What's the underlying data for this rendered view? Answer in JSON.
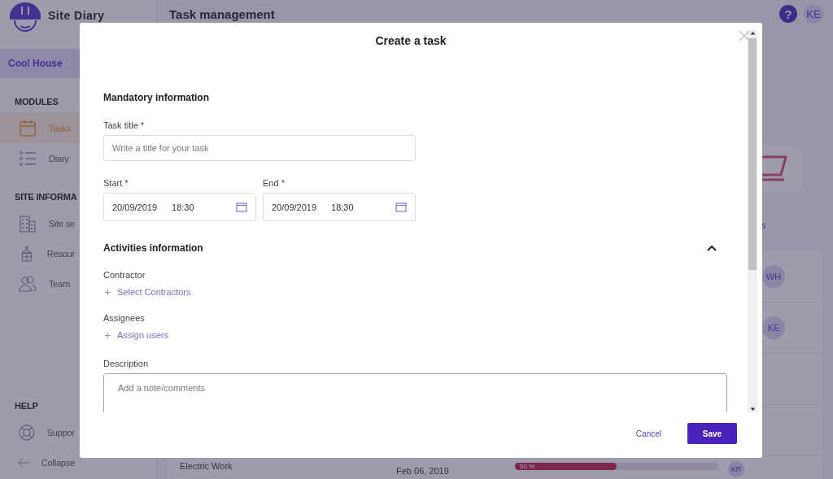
{
  "sidebar": {
    "app_name": "Site Diary",
    "project": "Cool House",
    "sections": [
      {
        "heading": "MODULES",
        "items": [
          {
            "label": "Tasks",
            "selected": true
          },
          {
            "label": "Diary",
            "selected": false
          }
        ]
      },
      {
        "heading": "SITE INFORMA",
        "items": [
          {
            "label": "Site se",
            "selected": false
          },
          {
            "label": "Resour",
            "selected": false
          },
          {
            "label": "Team",
            "selected": false
          }
        ]
      }
    ],
    "help": {
      "heading": "HELP",
      "items": [
        {
          "label": "Suppor",
          "selected": false
        },
        {
          "label": "Collapse",
          "selected": false
        }
      ]
    }
  },
  "header": {
    "title": "Task management",
    "help": "?",
    "avatar": "KE"
  },
  "tasks": {
    "column_header": "s",
    "rows": [
      {
        "avatar": "WH"
      },
      {
        "avatar": "KE"
      },
      {
        "name": "Electric Work",
        "date": "Feb 06, 2019",
        "level": 0.5,
        "reading": "50 %",
        "avatar": "KR"
      }
    ]
  },
  "modal": {
    "title": "Create a task",
    "mandatory": {
      "heading": "Mandatory information",
      "task_title": {
        "label": "Task title *",
        "placeholder": "Write a title for your task"
      },
      "start": {
        "label": "Start *",
        "date": "20/09/2019",
        "time": "18:30"
      },
      "end": {
        "label": "End *",
        "date": "20/09/2019",
        "time": "18:30"
      }
    },
    "activities": {
      "heading": "Activities information",
      "expanded": true,
      "contractor": {
        "label": "Contractor",
        "action": "Select Contractors"
      },
      "assignees": {
        "label": "Assignees",
        "action": "Assign users"
      },
      "description": {
        "label": "Description",
        "placeholder": "Add a note/comments"
      }
    },
    "buttons": {
      "cancel": "Cancel",
      "save": "Save"
    }
  }
}
